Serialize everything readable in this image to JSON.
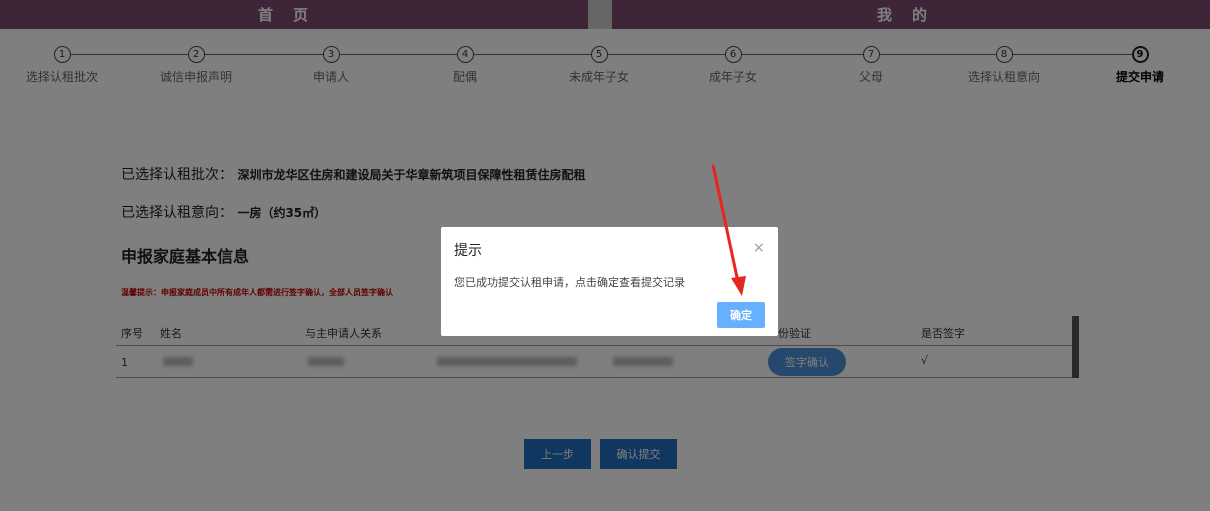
{
  "nav": {
    "home": "首页",
    "mine": "我的"
  },
  "steps": [
    {
      "num": "1",
      "label": "选择认租批次"
    },
    {
      "num": "2",
      "label": "诚信申报声明"
    },
    {
      "num": "3",
      "label": "申请人"
    },
    {
      "num": "4",
      "label": "配偶"
    },
    {
      "num": "5",
      "label": "未成年子女"
    },
    {
      "num": "6",
      "label": "成年子女"
    },
    {
      "num": "7",
      "label": "父母"
    },
    {
      "num": "8",
      "label": "选择认租意向"
    },
    {
      "num": "9",
      "label": "提交申请"
    }
  ],
  "active_step": 9,
  "info": {
    "batch_label": "已选择认租批次：",
    "batch_value": "深圳市龙华区住房和建设局关于华章新筑项目保障性租赁住房配租",
    "intent_label": "已选择认租意向：",
    "intent_value": "一房（约35㎡）"
  },
  "family": {
    "title": "申报家庭基本信息",
    "warning": "温馨提示：申报家庭成员中所有成年人都需进行签字确认，全部人员签字确认",
    "headers": {
      "seq": "序号",
      "name": "姓名",
      "relation": "与主申请人关系",
      "verify": "份验证",
      "signed": "是否签字"
    },
    "row": {
      "seq": "1",
      "sign_button": "签字确认",
      "signed": "√"
    }
  },
  "buttons": {
    "prev": "上一步",
    "submit": "确认提交"
  },
  "modal": {
    "title": "提示",
    "message": "您已成功提交认租申请，点击确定查看提交记录",
    "ok": "确定",
    "close": "×"
  },
  "colors": {
    "nav": "#7f4a70",
    "primary": "#1f6fbf",
    "ok": "#66b1ff",
    "warning": "#c00000"
  }
}
